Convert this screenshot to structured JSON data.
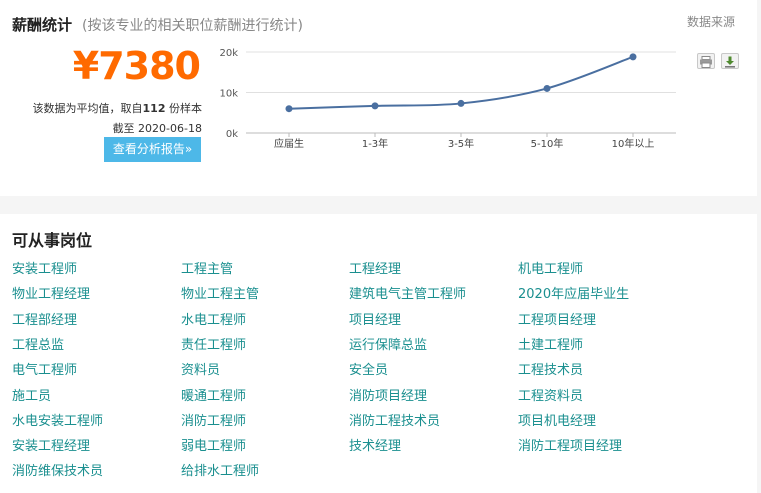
{
  "salary": {
    "title": "薪酬统计",
    "subtitle": "(按该专业的相关职位薪酬进行统计)",
    "source_link": "数据来源",
    "price": "¥7380",
    "note_prefix": "该数据为平均值，取自",
    "sample_count": "112",
    "note_suffix": " 份样本",
    "date_note": "截至 2020-06-18",
    "report_button": "查看分析报告»",
    "print_icon": "printer-icon",
    "download_icon": "download-icon"
  },
  "chart_data": {
    "type": "line",
    "categories": [
      "应届生",
      "1-3年",
      "3-5年",
      "5-10年",
      "10年以上"
    ],
    "values": [
      6000,
      6700,
      7300,
      11000,
      18800
    ],
    "ylim": [
      0,
      20000
    ],
    "yticks": [
      "0k",
      "10k",
      "20k"
    ],
    "ytick_values": [
      0,
      10000,
      20000
    ],
    "grid": true,
    "color": "#4a6fa0"
  },
  "jobs": {
    "title": "可从事岗位",
    "items": [
      "安装工程师",
      "工程主管",
      "工程经理",
      "机电工程师",
      "物业工程经理",
      "物业工程主管",
      "建筑电气主管工程师",
      "2020年应届毕业生",
      "工程部经理",
      "水电工程师",
      "项目经理",
      "工程项目经理",
      "工程总监",
      "责任工程师",
      "运行保障总监",
      "土建工程师",
      "电气工程师",
      "资料员",
      "安全员",
      "工程技术员",
      "施工员",
      "暖通工程师",
      "消防项目经理",
      "工程资料员",
      "水电安装工程师",
      "消防工程师",
      "消防工程技术员",
      "项目机电经理",
      "安装工程经理",
      "弱电工程师",
      "技术经理",
      "消防工程项目经理",
      "消防维保技术员",
      "给排水工程师"
    ]
  }
}
